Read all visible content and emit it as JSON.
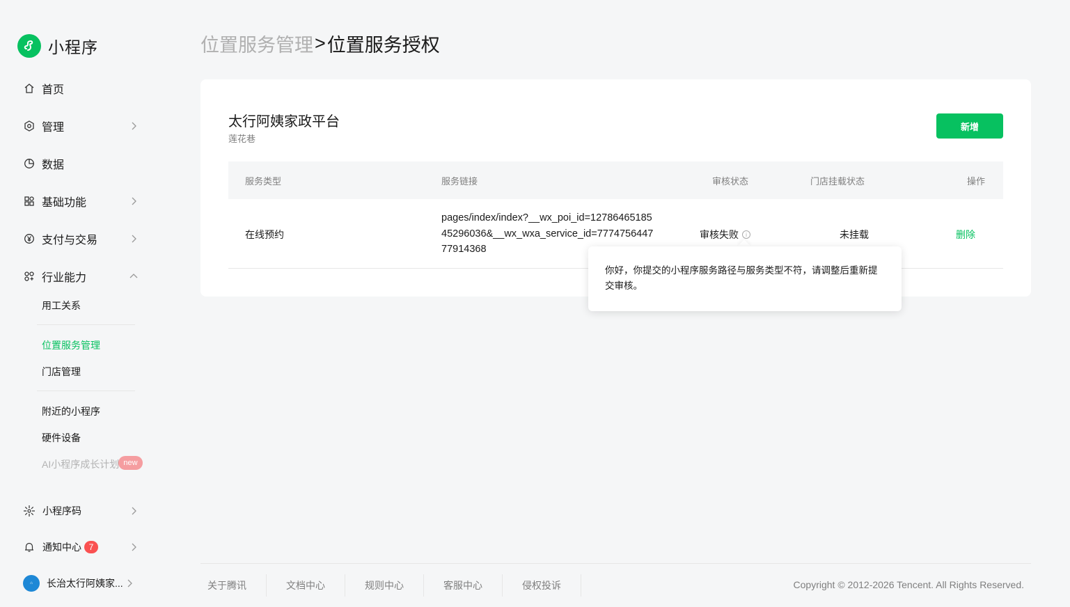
{
  "brand": {
    "name": "小程序",
    "accent": "#07c160"
  },
  "sidebar": {
    "items": [
      {
        "label": "首页",
        "icon": "home-icon"
      },
      {
        "label": "管理",
        "icon": "settings-icon"
      },
      {
        "label": "数据",
        "icon": "chart-icon"
      },
      {
        "label": "基础功能",
        "icon": "apps-icon"
      },
      {
        "label": "支付与交易",
        "icon": "yuan-icon"
      },
      {
        "label": "行业能力",
        "icon": "industry-icon"
      }
    ],
    "sub_items": [
      "用工关系",
      "位置服务管理",
      "门店管理",
      "附近的小程序",
      "硬件设备",
      "AI小程序成长计划"
    ],
    "new_badge": "new",
    "bottom": {
      "qrcode": "小程序码",
      "notice": "通知中心",
      "notice_count": "7",
      "account": "长治太行阿姨家..."
    }
  },
  "breadcrumb": {
    "parent": "位置服务管理",
    "separator": ">",
    "current": "位置服务授权"
  },
  "card": {
    "title": "太行阿姨家政平台",
    "subtitle": "莲花巷",
    "add_button": "新增"
  },
  "table": {
    "headers": [
      "服务类型",
      "服务链接",
      "审核状态",
      "门店挂载状态",
      "操作"
    ],
    "rows": [
      {
        "type": "在线预约",
        "link": "pages/index/index?__wx_poi_id=1278646518545296036&__wx_wxa_service_id=777475644777914368",
        "status": "审核失败",
        "mount": "未挂载",
        "action": "删除"
      }
    ]
  },
  "tooltip": {
    "text": "你好，你提交的小程序服务路径与服务类型不符，请调整后重新提交审核。"
  },
  "footer": {
    "links": [
      "关于腾讯",
      "文档中心",
      "规则中心",
      "客服中心",
      "侵权投诉"
    ],
    "copyright": "Copyright © 2012-2026 Tencent. All Rights Reserved."
  }
}
